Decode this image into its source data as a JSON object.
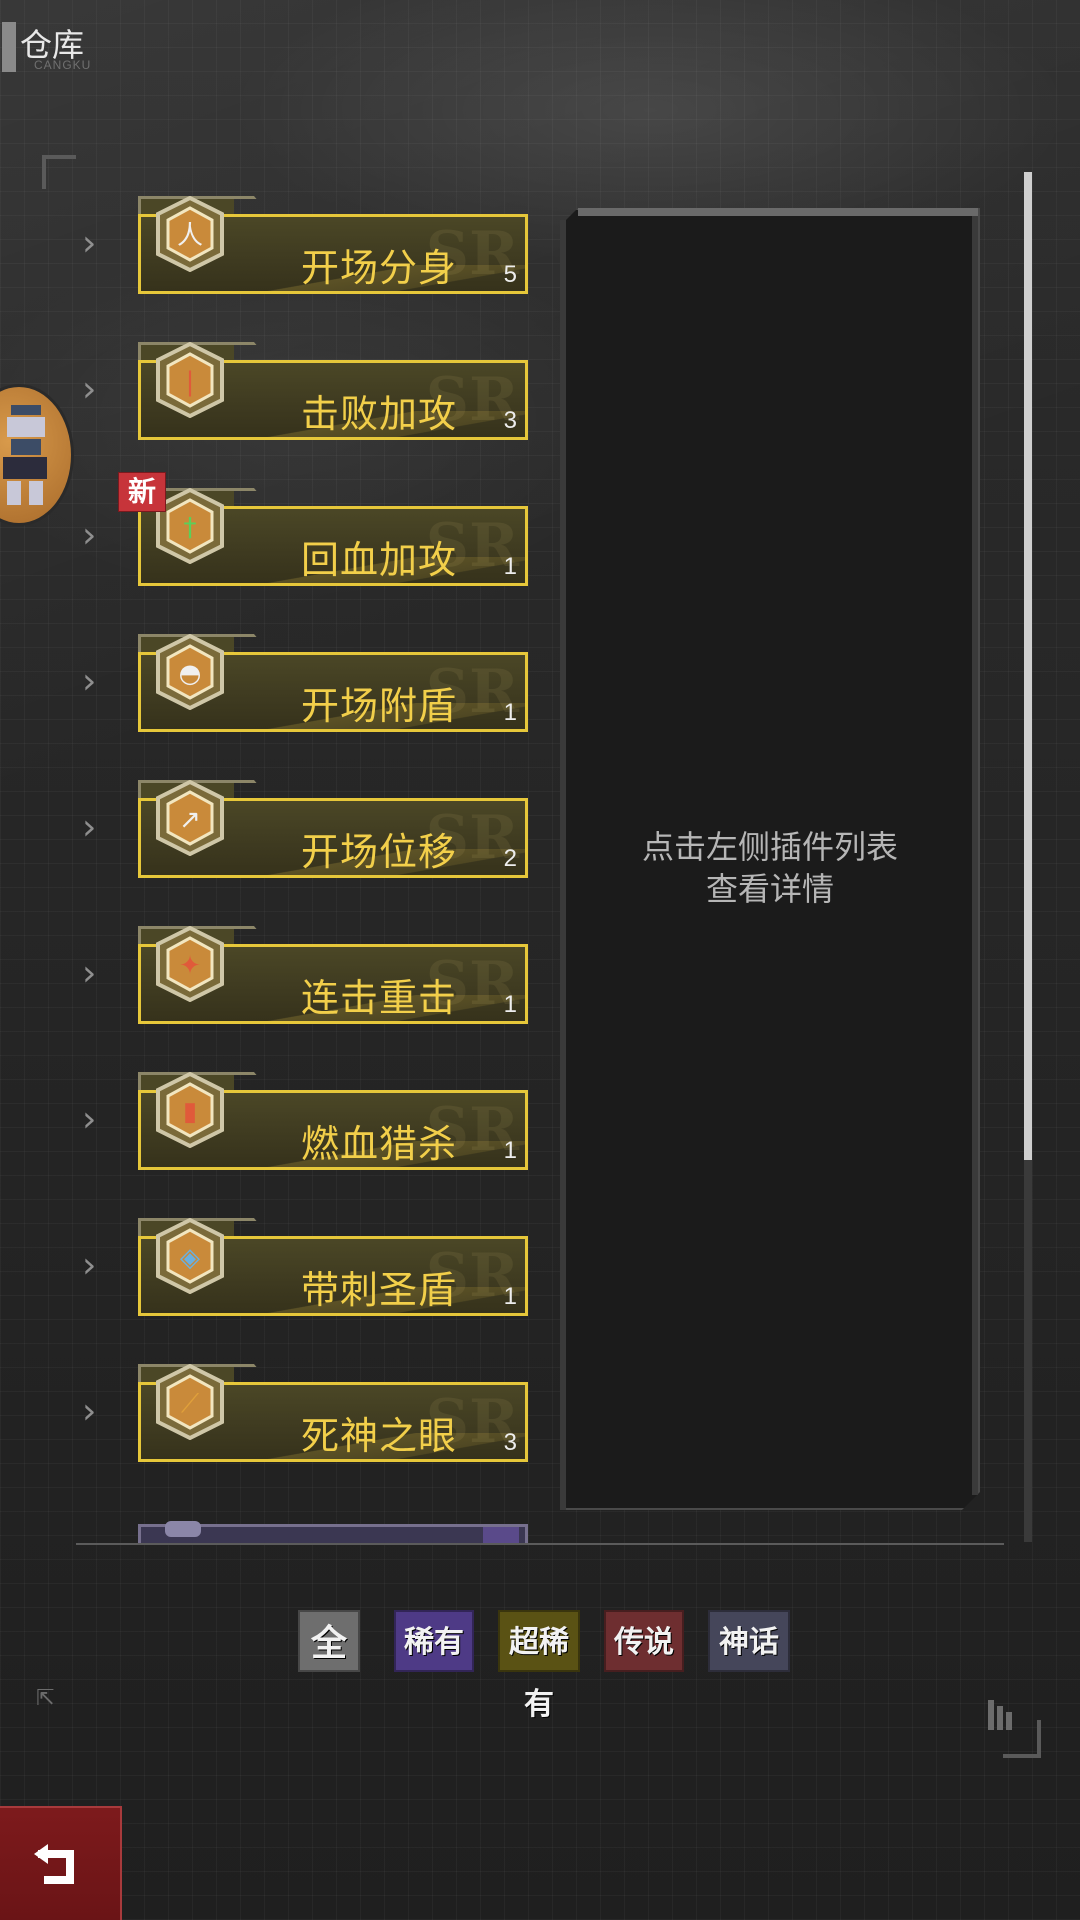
{
  "header": {
    "title": "仓库",
    "subtitle": "CANGKU"
  },
  "plugins": [
    {
      "name": "开场分身",
      "count": "5",
      "icon": "clone-icon",
      "is_new": false
    },
    {
      "name": "击败加攻",
      "count": "3",
      "icon": "sword-icon",
      "is_new": false
    },
    {
      "name": "回血加攻",
      "count": "1",
      "icon": "heal-sword-icon",
      "is_new": true
    },
    {
      "name": "开场附盾",
      "count": "1",
      "icon": "shield-icon",
      "is_new": false
    },
    {
      "name": "开场位移",
      "count": "2",
      "icon": "dash-icon",
      "is_new": false
    },
    {
      "name": "连击重击",
      "count": "1",
      "icon": "combo-icon",
      "is_new": false
    },
    {
      "name": "燃血猎杀",
      "count": "1",
      "icon": "blood-vial-icon",
      "is_new": false
    },
    {
      "name": "带刺圣盾",
      "count": "1",
      "icon": "thorn-shield-icon",
      "is_new": false
    },
    {
      "name": "死神之眼",
      "count": "3",
      "icon": "reaper-dagger-icon",
      "is_new": false
    }
  ],
  "new_badge_label": "新",
  "card_rarity_mark": "SR",
  "detail": {
    "hint_line1": "点击左侧插件列表",
    "hint_line2": "查看详情"
  },
  "filters": [
    {
      "label": "全",
      "color": "#6e6e6e",
      "active": true
    },
    {
      "label": "稀有",
      "color": "#4e3a86",
      "active": false
    },
    {
      "label": "超稀有",
      "color": "#5a5214",
      "active": false
    },
    {
      "label": "传说",
      "color": "#6e2e30",
      "active": false
    },
    {
      "label": "神话",
      "color": "#45465a",
      "active": false
    }
  ],
  "colors": {
    "card_border": "#e6c73a",
    "card_label": "#f2cf4a",
    "back_button": "#7d1a1c"
  }
}
